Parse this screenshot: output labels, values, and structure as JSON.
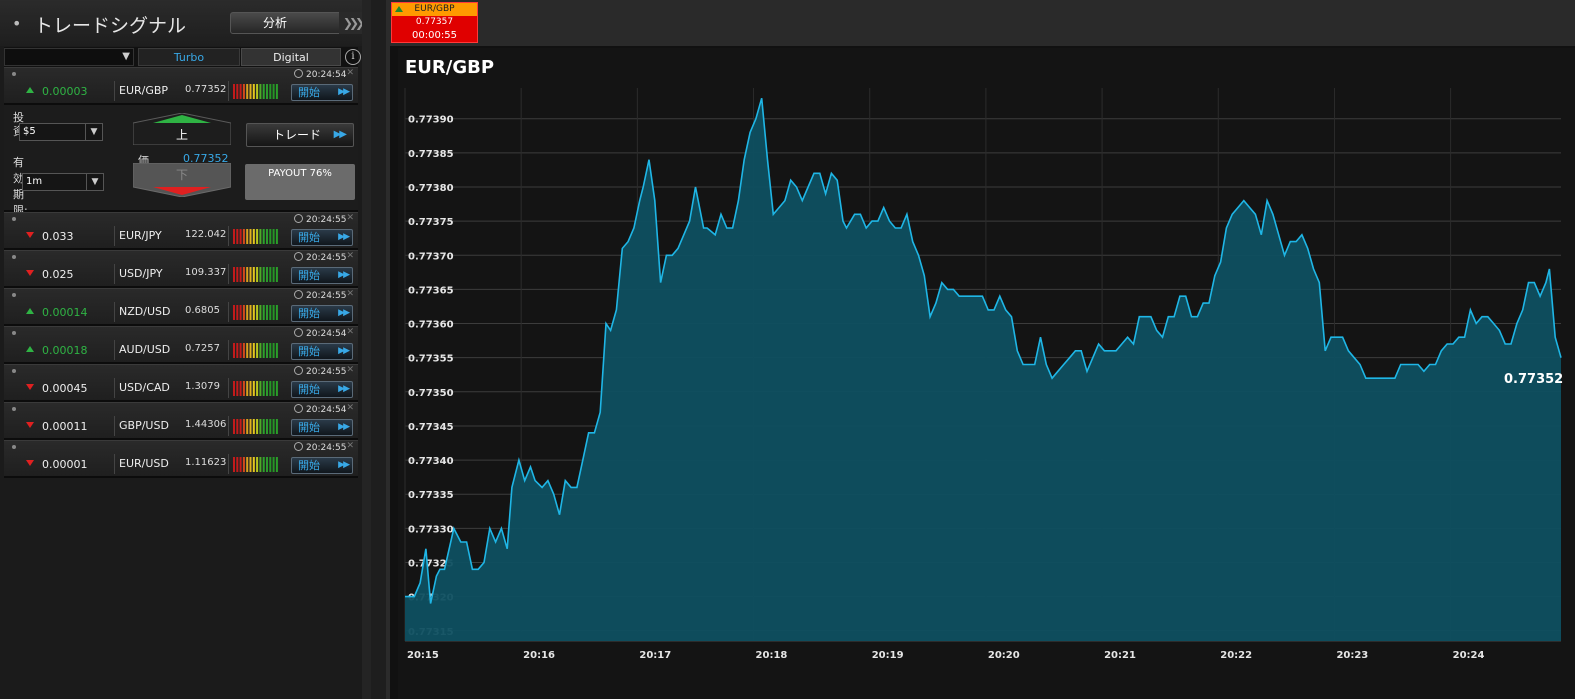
{
  "app": {
    "title": "トレードシグナル",
    "analysis_label": "分析"
  },
  "filters": {
    "select_value": "",
    "tabs": [
      {
        "label": "Turbo",
        "active": true
      },
      {
        "label": "Digital",
        "active": false
      }
    ],
    "info_icon": "info-icon"
  },
  "signals": [
    {
      "time": "20:24:54",
      "direction": "up",
      "change": "0.00003",
      "pair": "EUR/GBP",
      "price": "0.77352",
      "start_label": "開始"
    },
    {
      "time": "20:24:55",
      "direction": "down",
      "change": "0.033",
      "pair": "EUR/JPY",
      "price": "122.042",
      "start_label": "開始"
    },
    {
      "time": "20:24:55",
      "direction": "down",
      "change": "0.025",
      "pair": "USD/JPY",
      "price": "109.337",
      "start_label": "開始"
    },
    {
      "time": "20:24:55",
      "direction": "up",
      "change": "0.00014",
      "pair": "NZD/USD",
      "price": "0.6805",
      "start_label": "開始"
    },
    {
      "time": "20:24:54",
      "direction": "up",
      "change": "0.00018",
      "pair": "AUD/USD",
      "price": "0.7257",
      "start_label": "開始"
    },
    {
      "time": "20:24:55",
      "direction": "down",
      "change": "0.00045",
      "pair": "USD/CAD",
      "price": "1.3079",
      "start_label": "開始"
    },
    {
      "time": "20:24:54",
      "direction": "down",
      "change": "0.00011",
      "pair": "GBP/USD",
      "price": "1.44306",
      "start_label": "開始"
    },
    {
      "time": "20:24:55",
      "direction": "down",
      "change": "0.00001",
      "pair": "EUR/USD",
      "price": "1.11623",
      "start_label": "開始"
    }
  ],
  "trade_panel": {
    "invest_label": "投資:",
    "invest_value": "$5",
    "expiry_label": "有効期限:",
    "expiry_value": "1m",
    "up_label": "上",
    "down_label": "下",
    "price_label": "価",
    "price_value": "0.77352",
    "trade_label": "トレード",
    "payout_label": "PAYOUT 76%"
  },
  "ticker": {
    "pair": "EUR/GBP",
    "price": "0.77357",
    "countdown": "00:00:55",
    "direction": "up"
  },
  "colors": {
    "accent": "#38a8e6",
    "up": "#2fb344",
    "down": "#e02020",
    "chart_line": "#1fb6e6",
    "chart_fill": "#0e4f60"
  },
  "chart_data": {
    "type": "area",
    "title": "EUR/GBP",
    "xlabel": "",
    "ylabel": "",
    "last_value": "0.77352",
    "x_ticks": [
      "20:15",
      "20:16",
      "20:17",
      "20:18",
      "20:19",
      "20:20",
      "20:21",
      "20:22",
      "20:23",
      "20:24"
    ],
    "y_ticks": [
      "0.77315",
      "0.77320",
      "0.77325",
      "0.77330",
      "0.77335",
      "0.77340",
      "0.77345",
      "0.77350",
      "0.77355",
      "0.77360",
      "0.77365",
      "0.77370",
      "0.77375",
      "0.77380",
      "0.77385",
      "0.77390"
    ],
    "ylim": [
      0.773135,
      0.773945
    ],
    "xlim": [
      0,
      9.95
    ],
    "grid": true,
    "x": [
      0,
      0.08,
      0.13,
      0.18,
      0.22,
      0.27,
      0.3,
      0.34,
      0.42,
      0.48,
      0.53,
      0.58,
      0.63,
      0.68,
      0.73,
      0.78,
      0.83,
      0.88,
      0.92,
      0.95,
      0.98,
      1.03,
      1.08,
      1.12,
      1.18,
      1.23,
      1.28,
      1.33,
      1.38,
      1.43,
      1.48,
      1.53,
      1.58,
      1.63,
      1.68,
      1.73,
      1.77,
      1.82,
      1.87,
      1.92,
      1.97,
      2.02,
      2.05,
      2.1,
      2.15,
      2.2,
      2.25,
      2.3,
      2.35,
      2.4,
      2.45,
      2.5,
      2.57,
      2.6,
      2.67,
      2.72,
      2.77,
      2.82,
      2.87,
      2.92,
      2.97,
      3.02,
      3.07,
      3.12,
      3.17,
      3.22,
      3.27,
      3.32,
      3.37,
      3.42,
      3.47,
      3.52,
      3.57,
      3.62,
      3.67,
      3.72,
      3.77,
      3.8,
      3.87,
      3.92,
      3.97,
      4.02,
      4.07,
      4.12,
      4.17,
      4.22,
      4.27,
      4.32,
      4.37,
      4.42,
      4.47,
      4.52,
      4.57,
      4.62,
      4.67,
      4.72,
      4.77,
      4.82,
      4.87,
      4.92,
      4.97,
      5.02,
      5.07,
      5.12,
      5.17,
      5.22,
      5.27,
      5.32,
      5.37,
      5.42,
      5.47,
      5.52,
      5.57,
      5.62,
      5.67,
      5.72,
      5.77,
      5.82,
      5.87,
      5.92,
      5.97,
      6.02,
      6.07,
      6.12,
      6.17,
      6.22,
      6.27,
      6.32,
      6.37,
      6.42,
      6.47,
      6.52,
      6.57,
      6.62,
      6.67,
      6.72,
      6.77,
      6.82,
      6.87,
      6.92,
      6.97,
      7.02,
      7.07,
      7.12,
      7.17,
      7.22,
      7.27,
      7.32,
      7.37,
      7.42,
      7.47,
      7.52,
      7.57,
      7.62,
      7.67,
      7.72,
      7.77,
      7.82,
      7.87,
      7.92,
      7.97,
      8.02,
      8.07,
      8.12,
      8.17,
      8.22,
      8.27,
      8.32,
      8.37,
      8.42,
      8.47,
      8.52,
      8.57,
      8.62,
      8.67,
      8.72,
      8.77,
      8.82,
      8.87,
      8.92,
      8.97,
      9.02,
      9.07,
      9.12,
      9.17,
      9.22,
      9.27,
      9.32,
      9.37,
      9.42,
      9.47,
      9.52,
      9.57,
      9.62,
      9.67,
      9.72,
      9.77,
      9.82,
      9.85,
      9.9,
      9.95
    ],
    "values": [
      0.7732,
      0.7732,
      0.77322,
      0.77327,
      0.77319,
      0.77323,
      0.77324,
      0.77324,
      0.7733,
      0.77328,
      0.77328,
      0.77324,
      0.77324,
      0.77325,
      0.7733,
      0.77328,
      0.7733,
      0.77327,
      0.77336,
      0.77338,
      0.7734,
      0.77337,
      0.77339,
      0.77337,
      0.77336,
      0.77337,
      0.77335,
      0.77332,
      0.77337,
      0.77336,
      0.77336,
      0.7734,
      0.77344,
      0.77344,
      0.77347,
      0.7736,
      0.77359,
      0.77362,
      0.77371,
      0.77372,
      0.77374,
      0.77378,
      0.7738,
      0.77384,
      0.77378,
      0.77366,
      0.7737,
      0.7737,
      0.77371,
      0.77373,
      0.77375,
      0.7738,
      0.77374,
      0.77374,
      0.77373,
      0.77376,
      0.77374,
      0.77374,
      0.77378,
      0.77384,
      0.77388,
      0.7739,
      0.77393,
      0.77384,
      0.77376,
      0.77377,
      0.77378,
      0.77381,
      0.7738,
      0.77378,
      0.7738,
      0.77382,
      0.77382,
      0.77379,
      0.77382,
      0.77381,
      0.77375,
      0.77374,
      0.77376,
      0.77376,
      0.77374,
      0.77375,
      0.77375,
      0.77377,
      0.77375,
      0.77374,
      0.77374,
      0.77376,
      0.77372,
      0.7737,
      0.77367,
      0.77361,
      0.77363,
      0.77366,
      0.77365,
      0.77365,
      0.77364,
      0.77364,
      0.77364,
      0.77364,
      0.77364,
      0.77362,
      0.77362,
      0.77364,
      0.77362,
      0.77361,
      0.77356,
      0.77354,
      0.77354,
      0.77354,
      0.77358,
      0.77354,
      0.77352,
      0.77353,
      0.77354,
      0.77355,
      0.77356,
      0.77356,
      0.77353,
      0.77355,
      0.77357,
      0.77356,
      0.77356,
      0.77356,
      0.77357,
      0.77358,
      0.77357,
      0.77361,
      0.77361,
      0.77361,
      0.77359,
      0.77358,
      0.77361,
      0.77361,
      0.77364,
      0.77364,
      0.77361,
      0.77361,
      0.77363,
      0.77363,
      0.77367,
      0.77369,
      0.77374,
      0.77376,
      0.77377,
      0.77378,
      0.77377,
      0.77376,
      0.77373,
      0.77378,
      0.77376,
      0.77373,
      0.7737,
      0.77372,
      0.77372,
      0.77373,
      0.77371,
      0.77368,
      0.77366,
      0.77356,
      0.77358,
      0.77358,
      0.77358,
      0.77356,
      0.77355,
      0.77354,
      0.77352,
      0.77352,
      0.77352,
      0.77352,
      0.77352,
      0.77352,
      0.77354,
      0.77354,
      0.77354,
      0.77354,
      0.77353,
      0.77354,
      0.77354,
      0.77356,
      0.77357,
      0.77357,
      0.77358,
      0.77358,
      0.77362,
      0.7736,
      0.77361,
      0.77361,
      0.7736,
      0.77359,
      0.77357,
      0.77357,
      0.7736,
      0.77362,
      0.77366,
      0.77366,
      0.77364,
      0.77366,
      0.77368,
      0.77358,
      0.77355,
      0.77352
    ]
  }
}
